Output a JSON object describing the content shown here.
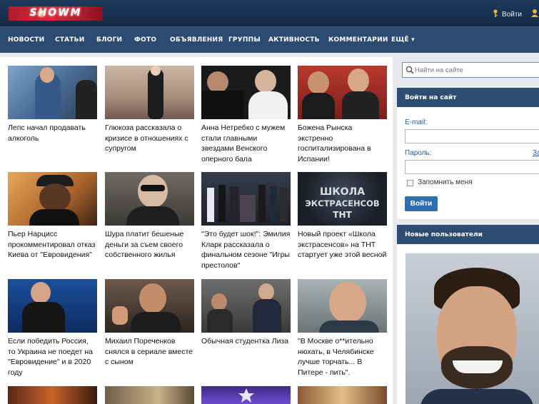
{
  "header": {
    "logo_text": "SHOWM",
    "login_label": "Войти"
  },
  "nav": {
    "items": [
      "НОВОСТИ",
      "СТАТЬИ",
      "БЛОГИ",
      "ФОТО",
      "ОБЪЯВЛЕНИЯ",
      "ГРУППЫ",
      "АКТИВНОСТЬ",
      "КОММЕНТАРИИ",
      "ЕЩЁ ▾"
    ]
  },
  "news": [
    {
      "caption": "Лепс начал продавать алкоголь"
    },
    {
      "caption": "Глюкоза рассказала о кризисе в отношениях с супругом"
    },
    {
      "caption": "Анна Нетребко с мужем стали главными звездами Венского оперного бала"
    },
    {
      "caption": "Божена Рынска экстренно госпитализирована в Испании!"
    },
    {
      "caption": "Пьер Нарцисс прокомментировал отказ Киева от \"Евровидения\""
    },
    {
      "caption": "Шура платит бешеные деньги за съем своего собственного жилья"
    },
    {
      "caption": "\"Это будет шок!\": Эмилия Кларк рассказала о финальном сезоне \"Игры престолов\""
    },
    {
      "caption": "Новый проект «Школа экстрасенсов» на ТНТ стартует уже этой весной"
    },
    {
      "caption": "Если победить Россия, то Украина не поедет на \"Евровидение\" и в 2020 году"
    },
    {
      "caption": "Михаил Пореченков снялся в сериале вместе с сыном"
    },
    {
      "caption": "Обычная студентка Лиза"
    },
    {
      "caption": "\"В Москве о**ительно нюхать, в Челябинске лучше торчать... В Питере - пить\"."
    }
  ],
  "thumb_overlay": {
    "school_line1": "ШКОЛА",
    "school_line2": "ЭКСТРАСЕНСОВ",
    "school_logo": "ТНТ"
  },
  "sidebar": {
    "search_placeholder": "Найти на сайте",
    "login_panel_title": "Войти на сайт",
    "email_label": "E-mail:",
    "password_label": "Пароль:",
    "forgot_link": "За",
    "remember_label": "Запомнить меня",
    "login_button": "Войти",
    "new_users_title": "Новые пользователи"
  },
  "colors": {
    "header_bg": "#1e3a5c",
    "nav_bg": "#2c4b70",
    "panel_head_bg": "#2d4c72",
    "button_bg": "#2d6fb1",
    "link": "#1f5c99"
  }
}
